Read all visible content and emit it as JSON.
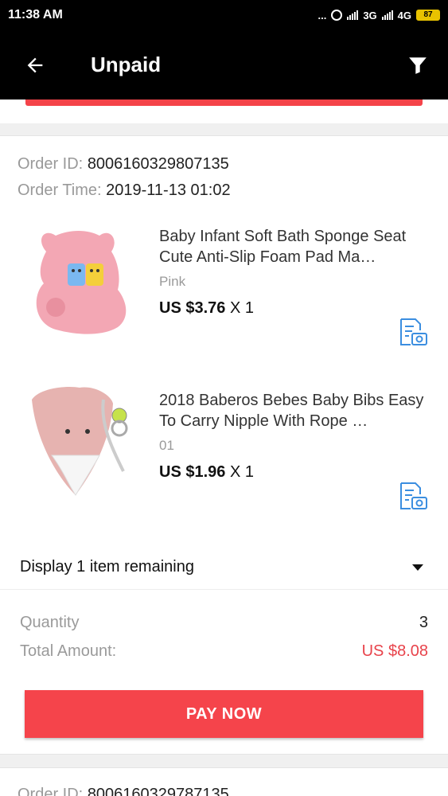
{
  "status_bar": {
    "time": "11:38 AM",
    "dots": "...",
    "net1": "3G",
    "net2": "4G",
    "battery": "87"
  },
  "header": {
    "title": "Unpaid"
  },
  "order": {
    "id_label": "Order ID:",
    "id_value": "8006160329807135",
    "time_label": "Order Time:",
    "time_value": "2019-11-13 01:02",
    "items": [
      {
        "title": "Baby Infant Soft Bath Sponge Seat Cute Anti-Slip Foam Pad Ma…",
        "variant": "Pink",
        "price": "US $3.76",
        "qty": "X 1"
      },
      {
        "title": "2018 Baberos Bebes Baby Bibs Easy To Carry Nipple With Rope …",
        "variant": "01",
        "price": "US $1.96",
        "qty": "X 1"
      }
    ],
    "remaining_label": "Display 1 item remaining",
    "quantity_label": "Quantity",
    "quantity_value": "3",
    "total_label": "Total Amount:",
    "total_value": "US $8.08",
    "pay_label": "PAY NOW"
  },
  "next_order": {
    "id_label": "Order ID:",
    "id_value": "8006160329787135"
  },
  "colors": {
    "accent_red": "#f5444b",
    "price_red": "#e8434b",
    "icon_blue": "#3b8ee0"
  }
}
